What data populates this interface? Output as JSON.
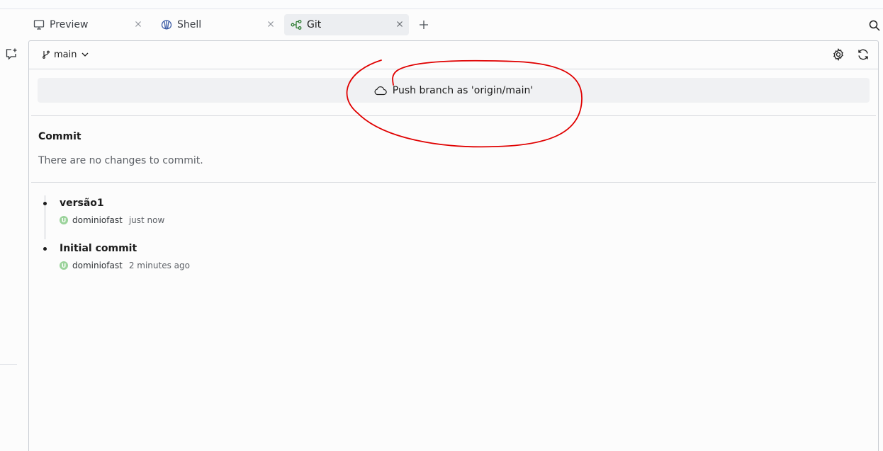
{
  "tabs": [
    {
      "label": "Preview",
      "icon": "monitor-icon",
      "active": false
    },
    {
      "label": "Shell",
      "icon": "shell-icon",
      "active": false
    },
    {
      "label": "Git",
      "icon": "git-icon",
      "active": true
    }
  ],
  "git": {
    "branch": "main",
    "push_label": "Push branch as 'origin/main'",
    "commit_heading": "Commit",
    "no_changes": "There are no changes to commit.",
    "commits": [
      {
        "message": "versão1",
        "author": "dominiofast",
        "time": "just now"
      },
      {
        "message": "Initial commit",
        "author": "dominiofast",
        "time": "2 minutes ago"
      }
    ]
  },
  "colors": {
    "annotation": "#e00000",
    "git_icon": "#2e7d32",
    "shell_icon": "#3b5ba5",
    "avatar": "#9bd39b"
  }
}
